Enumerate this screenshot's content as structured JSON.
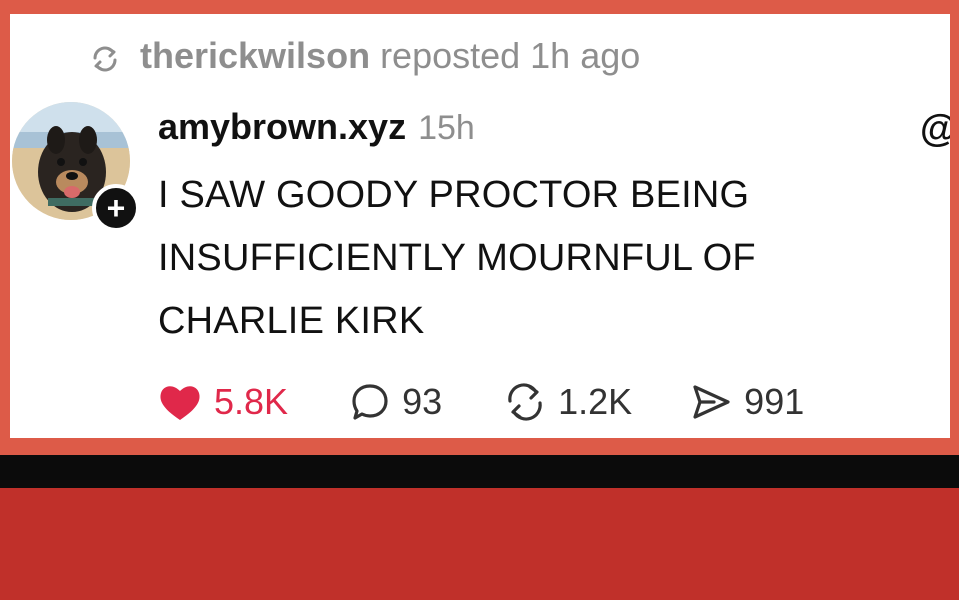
{
  "repost": {
    "user": "therickwilson",
    "rest": "reposted 1h ago",
    "icon": "repost-icon"
  },
  "post": {
    "author": "amybrown.xyz",
    "time": "15h",
    "text": "I SAW GOODY PROCTOR BEING INSUFFICIENTLY MOURNFUL OF CHARLIE KIRK",
    "follow_badge": "+",
    "overflow_glyph": "@"
  },
  "actions": {
    "likes": {
      "count": "5.8K",
      "icon": "heart-icon",
      "color": "#e0284a"
    },
    "replies": {
      "count": "93",
      "icon": "comment-icon"
    },
    "reposts": {
      "count": "1.2K",
      "icon": "repost-icon"
    },
    "shares": {
      "count": "991",
      "icon": "share-icon"
    }
  },
  "colors": {
    "frame": "#dd5b48",
    "bottom": "#c0302a",
    "band": "#0b0b0b",
    "card": "#ffffff"
  }
}
